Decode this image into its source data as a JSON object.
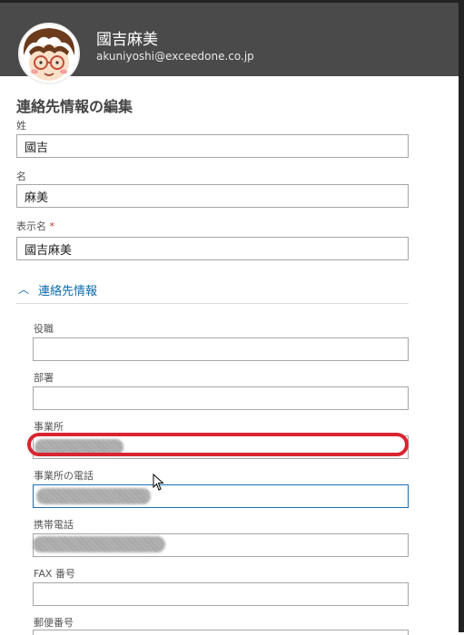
{
  "header": {
    "user_name": "國吉麻美",
    "user_email": "akuniyoshi@exceedone.co.jp",
    "avatar_icon": "cartoon-face-avatar"
  },
  "page": {
    "title": "連絡先情報の編集"
  },
  "fields": {
    "last_name": {
      "label": "姓",
      "value": "國吉"
    },
    "first_name": {
      "label": "名",
      "value": "麻美"
    },
    "display_name": {
      "label": "表示名",
      "required_mark": "*",
      "value": "國吉麻美"
    }
  },
  "section": {
    "label": "連絡先情報",
    "state": "expanded"
  },
  "contact_fields": {
    "job_title": {
      "label": "役職",
      "value": ""
    },
    "department": {
      "label": "部署",
      "value": ""
    },
    "office": {
      "label": "事業所",
      "value": ""
    },
    "office_phone": {
      "label": "事業所の電話",
      "value": ""
    },
    "mobile_phone": {
      "label": "携帯電話",
      "value": ""
    },
    "fax": {
      "label": "FAX 番号",
      "value": ""
    },
    "postal_code": {
      "label": "郵便番号"
    }
  },
  "colors": {
    "header_bg": "#4a4a4a",
    "accent": "#0e6cab",
    "highlight": "#d92530",
    "required": "#c0392b"
  }
}
